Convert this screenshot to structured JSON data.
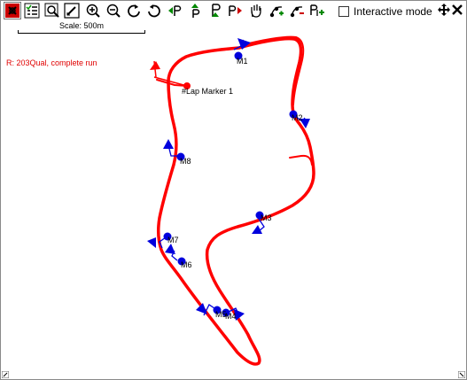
{
  "toolbar": {
    "buttons": [
      {
        "name": "track-map-icon",
        "active": true
      },
      {
        "name": "properties-list-icon",
        "active": false
      },
      {
        "name": "zoom-fit-icon",
        "active": false
      },
      {
        "name": "edit-track-icon",
        "active": false
      },
      {
        "name": "zoom-in-icon",
        "active": false
      },
      {
        "name": "zoom-out-icon",
        "active": false
      },
      {
        "name": "rotate-clockwise-icon",
        "active": false
      },
      {
        "name": "rotate-counterclockwise-icon",
        "active": false
      },
      {
        "name": "previous-marker-icon",
        "active": false
      },
      {
        "name": "place-marker-icon",
        "active": false
      },
      {
        "name": "marker-flag-icon",
        "active": false
      },
      {
        "name": "next-marker-icon",
        "active": false
      },
      {
        "name": "pan-hand-icon",
        "active": false
      },
      {
        "name": "add-marker-icon",
        "active": false
      },
      {
        "name": "remove-marker-icon",
        "active": false
      },
      {
        "name": "add-segment-icon",
        "active": false
      }
    ],
    "interactive_mode_label": "Interactive mode",
    "interactive_mode_checked": false
  },
  "scale": {
    "label": "Scale: 500m"
  },
  "run": {
    "label": "R:  203Qual, complete run",
    "color": "#e00000"
  },
  "track": {
    "color": "#ff0000",
    "marker_color": "#0000dd"
  },
  "lap_marker": {
    "label": "#Lap Marker 1"
  },
  "markers": [
    {
      "label": "M1"
    },
    {
      "label": "M2"
    },
    {
      "label": "M3"
    },
    {
      "label": "M4"
    },
    {
      "label": "M5"
    },
    {
      "label": "M6"
    },
    {
      "label": "M7"
    },
    {
      "label": "M8"
    }
  ]
}
